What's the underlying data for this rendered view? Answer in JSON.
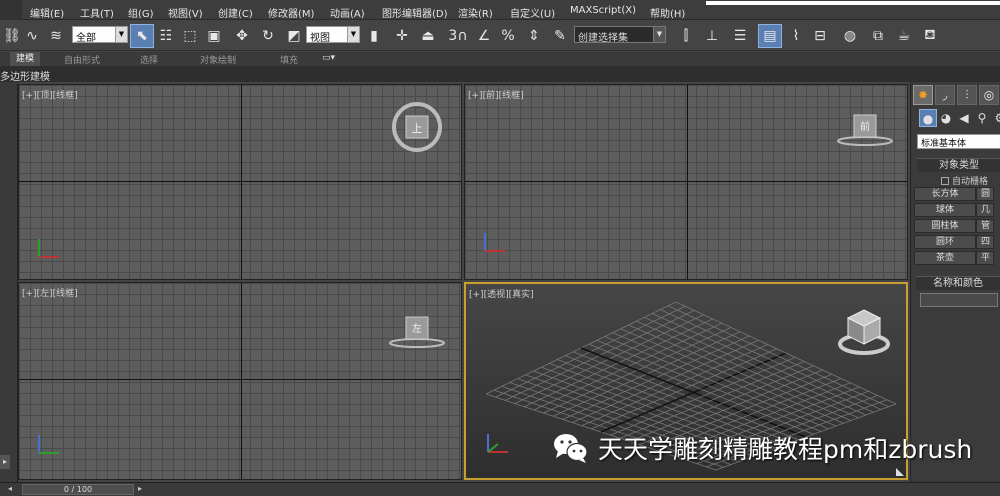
{
  "menu": {
    "items": [
      "编辑(E)",
      "工具(T)",
      "组(G)",
      "视图(V)",
      "创建(C)",
      "修改器(M)",
      "动画(A)",
      "图形编辑器(D)",
      "渲染(R)",
      "自定义(U)",
      "MAXScript(X)",
      "帮助(H)"
    ]
  },
  "toolbar": {
    "filter_select": "全部",
    "refcoord_select": "视图",
    "selection_set_select": "创建选择集",
    "spinner_snap_label": "3"
  },
  "ribbon": {
    "tabs": [
      "建模",
      "自由形式",
      "选择",
      "对象绘制",
      "填充"
    ],
    "active_tab": "建模",
    "sub_label": "多边形建模"
  },
  "viewports": {
    "top_label": "[+][顶][线框]",
    "front_label": "[+][前][线框]",
    "left_label": "[+][左][线框]",
    "persp_label": "[+][透视][真实]",
    "top_cube_text": "上",
    "front_cube_text": "前",
    "left_cube_text": "左"
  },
  "command_panel": {
    "category_select": "标准基本体",
    "object_type_title": "对象类型",
    "autogrid_label": "自动栅格",
    "buttons": [
      "长方体",
      "球体",
      "圆柱体",
      "圆环",
      "茶壶"
    ],
    "buttons_right": [
      "圆",
      "几",
      "管",
      "四",
      "平"
    ],
    "name_color_title": "名称和颜色"
  },
  "timeline": {
    "frame_label": "0 / 100"
  },
  "watermark": {
    "text": "天天学雕刻精雕教程pm和zbrush",
    "icon": "wechat-icon"
  },
  "colors": {
    "active_border": "#c8a030",
    "active_button": "#5a7fb2"
  }
}
